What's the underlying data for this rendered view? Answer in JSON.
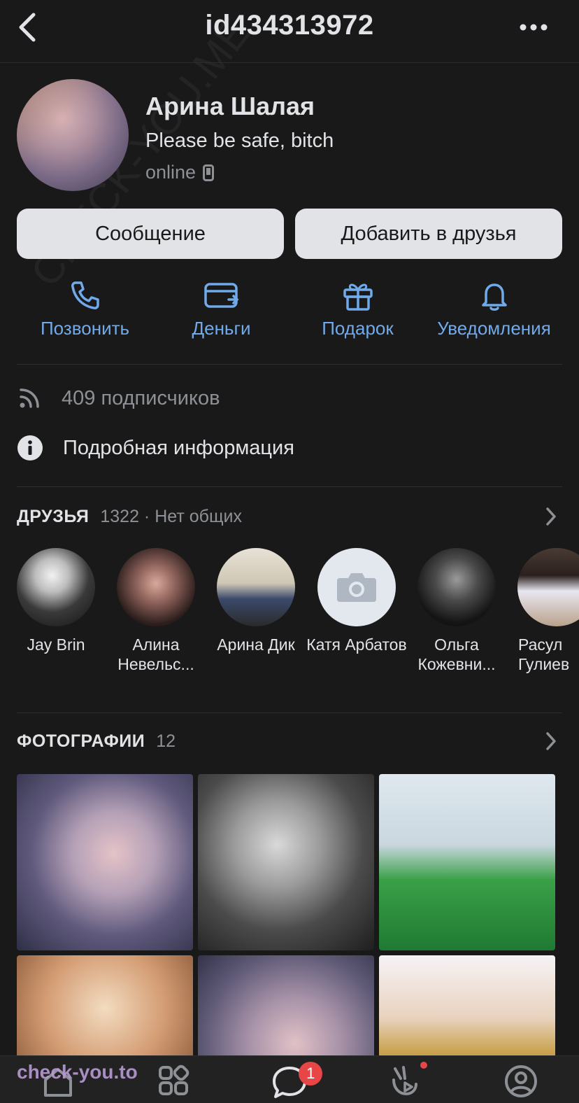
{
  "header": {
    "title": "id434313972"
  },
  "profile": {
    "name": "Арина Шалая",
    "status": "Please be safe, bitch",
    "online": "online"
  },
  "buttons": {
    "message": "Сообщение",
    "add_friend": "Добавить в друзья"
  },
  "actions": [
    {
      "label": "Позвонить",
      "icon": "phone-icon"
    },
    {
      "label": "Деньги",
      "icon": "money-card-icon"
    },
    {
      "label": "Подарок",
      "icon": "gift-icon"
    },
    {
      "label": "Уведомления",
      "icon": "bell-icon"
    }
  ],
  "info": {
    "followers": "409 подписчиков",
    "details": "Подробная информация"
  },
  "friends": {
    "title": "ДРУЗЬЯ",
    "count": "1322 · Нет общих",
    "items": [
      {
        "name": "Jay Brin"
      },
      {
        "name": "Алина Невельс..."
      },
      {
        "name": "Арина Дик"
      },
      {
        "name": "Катя Арбатов"
      },
      {
        "name": "Ольга Кожевни..."
      },
      {
        "name": "Расул Гулиев"
      }
    ]
  },
  "photos": {
    "title": "ФОТОГРАФИИ",
    "count": "12"
  },
  "tabbar": {
    "messages_badge": "1"
  },
  "watermarks": {
    "bottom": "check-you.to",
    "diagonal": "CHECK-YOU.ME"
  },
  "colors": {
    "background": "#19191a",
    "accent": "#71aaeb",
    "button_bg": "#e1e3e6",
    "badge": "#e64646"
  }
}
